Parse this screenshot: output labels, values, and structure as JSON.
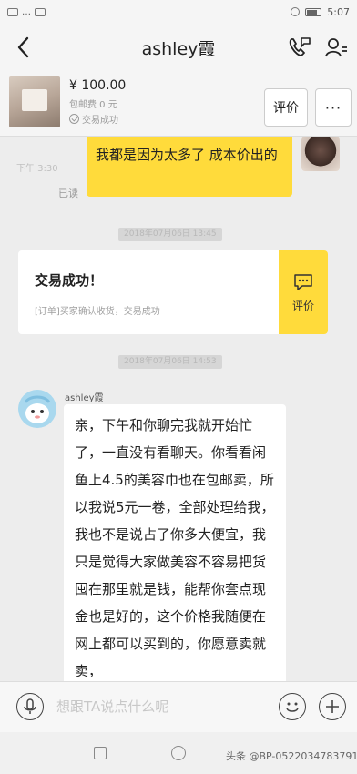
{
  "status_bar": {
    "left_text": "…",
    "time": "5:07"
  },
  "header": {
    "title": "ashley霞"
  },
  "product": {
    "price": "¥ 100.00",
    "shipping": "包邮费 0 元",
    "status": "交易成功",
    "review_label": "评价",
    "more_label": "···"
  },
  "chat": {
    "faint_time": "下午 3:30",
    "sent_message": "我都是因为太多了 成本价出的",
    "read_label": "已读",
    "timestamp_1": "2018年07月06日 13:45",
    "deal_card": {
      "title": "交易成功！",
      "desc": "[订单]买家确认收货，交易成功",
      "review_label": "评价"
    },
    "timestamp_2": "2018年07月06日 14:53",
    "sender_name": "ashley霞",
    "received_message": "亲，下午和你聊完我就开始忙了，一直没有看聊天。你看看闲鱼上4.5的美容巾也在包邮卖，所以我说5元一卷，全部处理给我，我也不是说占了你多大便宜，我只是觉得大家做美容不容易把货囤在那里就是钱，能帮你套点现金也是好的，这个价格我随便在网上都可以买到的，你愿意卖就卖，"
  },
  "input": {
    "placeholder": "想跟TA说点什么呢"
  },
  "nav": {
    "watermark": "头条 @BP-0522034783791"
  },
  "colors": {
    "accent_yellow": "#ffdb3b",
    "background": "#ededed"
  }
}
